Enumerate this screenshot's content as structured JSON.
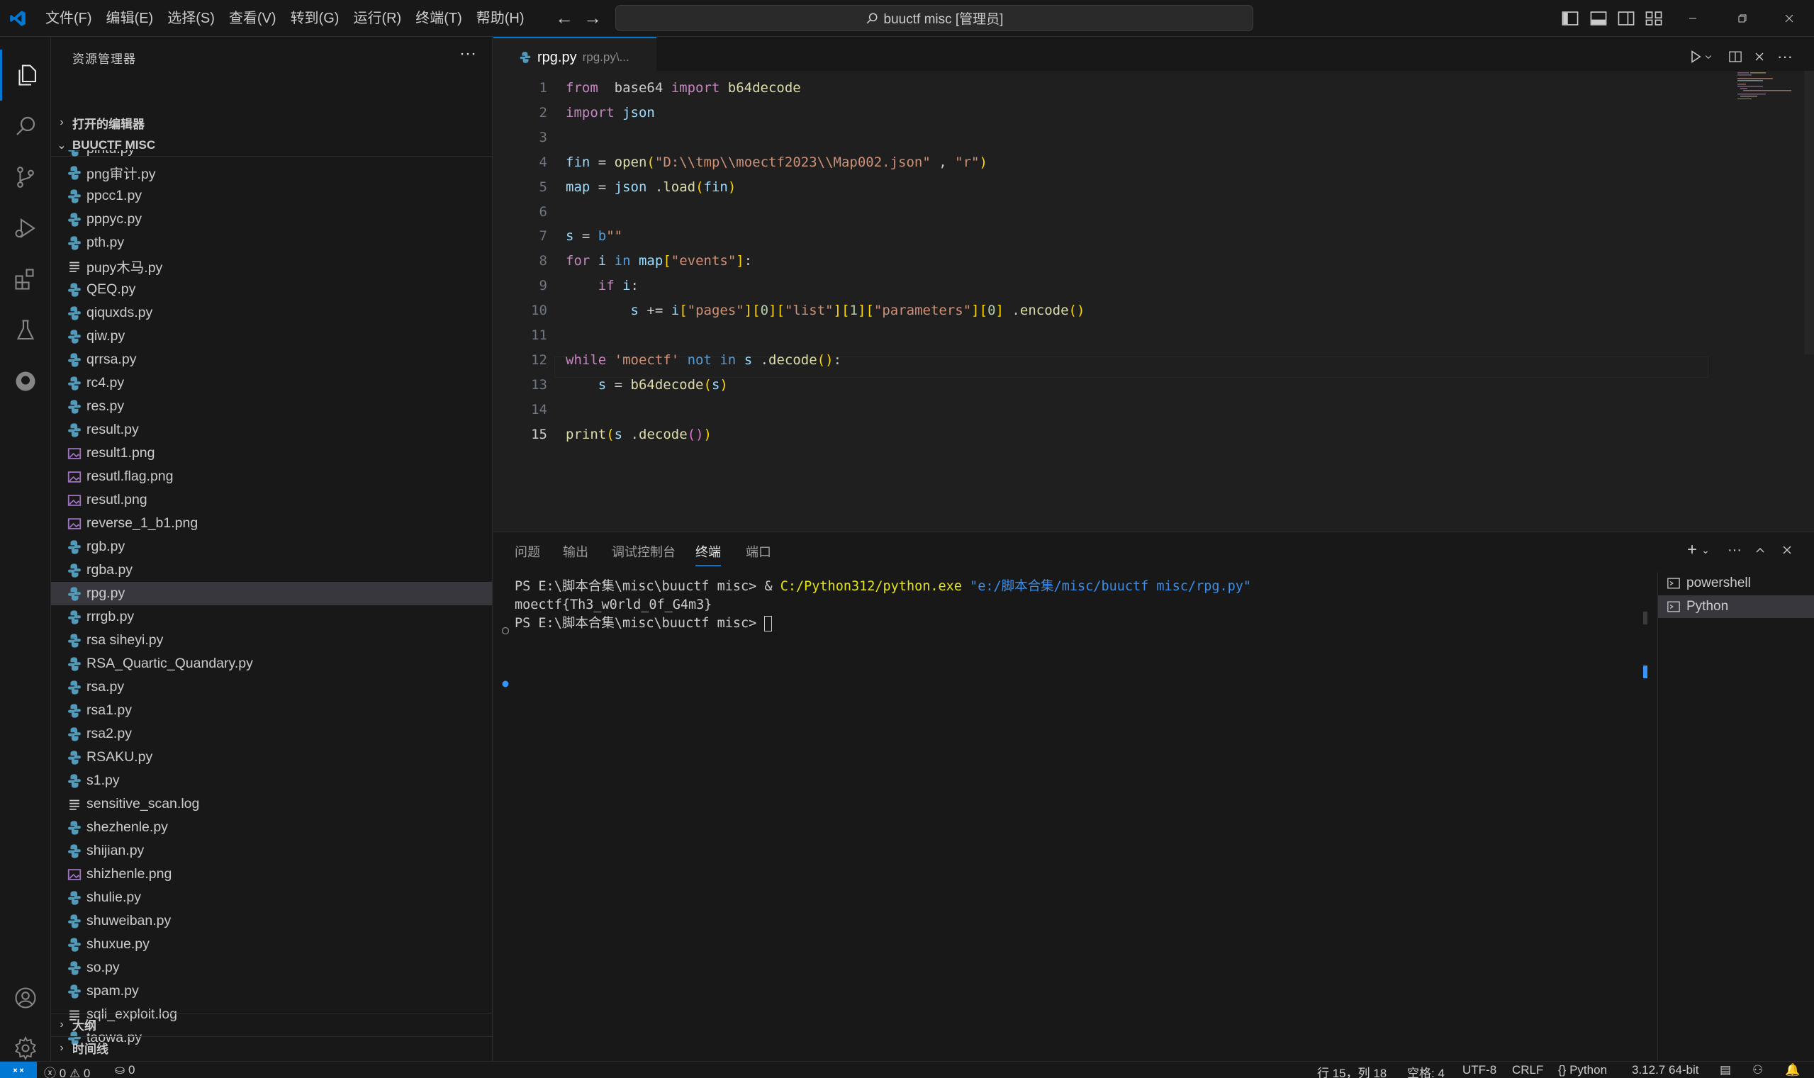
{
  "titlebar": {
    "menus": [
      "文件(F)",
      "编辑(E)",
      "选择(S)",
      "查看(V)",
      "转到(G)",
      "运行(R)",
      "终端(T)",
      "帮助(H)"
    ],
    "search_text": "buuctf misc [管理员]"
  },
  "sidebar": {
    "title": "资源管理器",
    "open_editors": "打开的编辑器",
    "workspace": "BUUCTF MISC",
    "outline": "大纲",
    "timeline": "时间线",
    "files": [
      {
        "name": "pintu.py",
        "type": "py"
      },
      {
        "name": "png审计.py",
        "type": "py"
      },
      {
        "name": "ppcc1.py",
        "type": "py"
      },
      {
        "name": "pppyc.py",
        "type": "py"
      },
      {
        "name": "pth.py",
        "type": "py"
      },
      {
        "name": "pupy木马.py",
        "type": "txt"
      },
      {
        "name": "QEQ.py",
        "type": "py"
      },
      {
        "name": "qiquxds.py",
        "type": "py"
      },
      {
        "name": "qiw.py",
        "type": "py"
      },
      {
        "name": "qrrsa.py",
        "type": "py"
      },
      {
        "name": "rc4.py",
        "type": "py"
      },
      {
        "name": "res.py",
        "type": "py"
      },
      {
        "name": "result.py",
        "type": "py"
      },
      {
        "name": "result1.png",
        "type": "png"
      },
      {
        "name": "resutl.flag.png",
        "type": "png"
      },
      {
        "name": "resutl.png",
        "type": "png"
      },
      {
        "name": "reverse_1_b1.png",
        "type": "png"
      },
      {
        "name": "rgb.py",
        "type": "py"
      },
      {
        "name": "rgba.py",
        "type": "py"
      },
      {
        "name": "rpg.py",
        "type": "py",
        "active": true
      },
      {
        "name": "rrrgb.py",
        "type": "py"
      },
      {
        "name": "rsa siheyi.py",
        "type": "py"
      },
      {
        "name": "RSA_Quartic_Quandary.py",
        "type": "py"
      },
      {
        "name": "rsa.py",
        "type": "py"
      },
      {
        "name": "rsa1.py",
        "type": "py"
      },
      {
        "name": "rsa2.py",
        "type": "py"
      },
      {
        "name": "RSAKU.py",
        "type": "py"
      },
      {
        "name": "s1.py",
        "type": "py"
      },
      {
        "name": "sensitive_scan.log",
        "type": "txt"
      },
      {
        "name": "shezhenle.py",
        "type": "py"
      },
      {
        "name": "shijian.py",
        "type": "py"
      },
      {
        "name": "shizhenle.png",
        "type": "png"
      },
      {
        "name": "shulie.py",
        "type": "py"
      },
      {
        "name": "shuweiban.py",
        "type": "py"
      },
      {
        "name": "shuxue.py",
        "type": "py"
      },
      {
        "name": "so.py",
        "type": "py"
      },
      {
        "name": "spam.py",
        "type": "py"
      },
      {
        "name": "sqli_exploit.log",
        "type": "txt"
      },
      {
        "name": "taowa.py",
        "type": "py"
      }
    ]
  },
  "editor": {
    "tab_name": "rpg.py",
    "tab_path": "rpg.py\\...",
    "current_line": 15,
    "lines": [
      [
        [
          "kw",
          "from"
        ],
        [
          "",
          "  base64 "
        ],
        [
          "kw",
          "import"
        ],
        [
          "fn",
          " b64decode"
        ]
      ],
      [
        [
          "kw",
          "import"
        ],
        [
          "var",
          " json"
        ]
      ],
      [],
      [
        [
          "var",
          "fin"
        ],
        [
          "",
          " = "
        ],
        [
          "fn",
          "open"
        ],
        [
          "br1",
          "("
        ],
        [
          "str",
          "\"D:\\\\tmp\\\\moectf2023\\\\Map002.json\""
        ],
        [
          "",
          " , "
        ],
        [
          "str",
          "\"r\""
        ],
        [
          "br1",
          ")"
        ]
      ],
      [
        [
          "var",
          "map"
        ],
        [
          "",
          " = "
        ],
        [
          "var",
          "json"
        ],
        [
          "",
          " ."
        ],
        [
          "fn",
          "load"
        ],
        [
          "br1",
          "("
        ],
        [
          "var",
          "fin"
        ],
        [
          "br1",
          ")"
        ]
      ],
      [],
      [
        [
          "var",
          "s"
        ],
        [
          "",
          " = "
        ],
        [
          "kb",
          "b"
        ],
        [
          "str",
          "\"\""
        ]
      ],
      [
        [
          "kw",
          "for"
        ],
        [
          "var",
          " i"
        ],
        [
          "kb",
          " in"
        ],
        [
          "var",
          " map"
        ],
        [
          "br1",
          "["
        ],
        [
          "str",
          "\"events\""
        ],
        [
          "br1",
          "]"
        ],
        [
          "",
          ":"
        ]
      ],
      [
        [
          "",
          "    "
        ],
        [
          "kw",
          "if"
        ],
        [
          "var",
          " i"
        ],
        [
          "",
          ":"
        ]
      ],
      [
        [
          "",
          "        "
        ],
        [
          "var",
          "s"
        ],
        [
          "",
          " += "
        ],
        [
          "var",
          "i"
        ],
        [
          "br1",
          "["
        ],
        [
          "str",
          "\"pages\""
        ],
        [
          "br1",
          "]"
        ],
        [
          "br1",
          "["
        ],
        [
          "num",
          "0"
        ],
        [
          "br1",
          "]"
        ],
        [
          "br1",
          "["
        ],
        [
          "str",
          "\"list\""
        ],
        [
          "br1",
          "]"
        ],
        [
          "br1",
          "["
        ],
        [
          "num",
          "1"
        ],
        [
          "br1",
          "]"
        ],
        [
          "br1",
          "["
        ],
        [
          "str",
          "\"parameters\""
        ],
        [
          "br1",
          "]"
        ],
        [
          "br1",
          "["
        ],
        [
          "num",
          "0"
        ],
        [
          "br1",
          "]"
        ],
        [
          "",
          " ."
        ],
        [
          "fn",
          "encode"
        ],
        [
          "br1",
          "()"
        ]
      ],
      [],
      [
        [
          "kw",
          "while"
        ],
        [
          "str",
          " 'moectf'"
        ],
        [
          "kb",
          " not"
        ],
        [
          "kb",
          " in"
        ],
        [
          "var",
          " s"
        ],
        [
          "",
          " ."
        ],
        [
          "fn",
          "decode"
        ],
        [
          "br1",
          "()"
        ],
        [
          "",
          ":"
        ]
      ],
      [
        [
          "",
          "    "
        ],
        [
          "var",
          "s"
        ],
        [
          "",
          " = "
        ],
        [
          "fn",
          "b64decode"
        ],
        [
          "br1",
          "("
        ],
        [
          "var",
          "s"
        ],
        [
          "br1",
          ")"
        ]
      ],
      [],
      [
        [
          "fn",
          "print"
        ],
        [
          "br1",
          "("
        ],
        [
          "var",
          "s"
        ],
        [
          "",
          " ."
        ],
        [
          "fn",
          "decode"
        ],
        [
          "br2",
          "()"
        ],
        [
          "br1",
          ")"
        ]
      ]
    ]
  },
  "panel": {
    "tabs": [
      "问题",
      "输出",
      "调试控制台",
      "终端",
      "端口"
    ],
    "active_tab": "终端",
    "terminal": {
      "line1_prompt": "PS E:\\脚本合集\\misc\\buuctf misc> & ",
      "line1_exe": "C:/Python312/python.exe",
      "line1_arg": " \"e:/脚本合集/misc/buuctf misc/rpg.py\"",
      "line2": "moectf{Th3_w0rld_0f_G4m3}",
      "line3_prompt": "PS E:\\脚本合集\\misc\\buuctf misc> "
    },
    "terminals": [
      "powershell",
      "Python"
    ]
  },
  "statusbar": {
    "errors": "0",
    "warnings": "0",
    "ports": "0",
    "position": "行 15，列 18",
    "spaces": "空格: 4",
    "encoding": "UTF-8",
    "eol": "CRLF",
    "language": "Python",
    "interpreter": "3.12.7 64-bit"
  },
  "colors": {
    "accent": "#0078d4",
    "python_icon": "#519aba",
    "image_icon": "#a074c4"
  }
}
